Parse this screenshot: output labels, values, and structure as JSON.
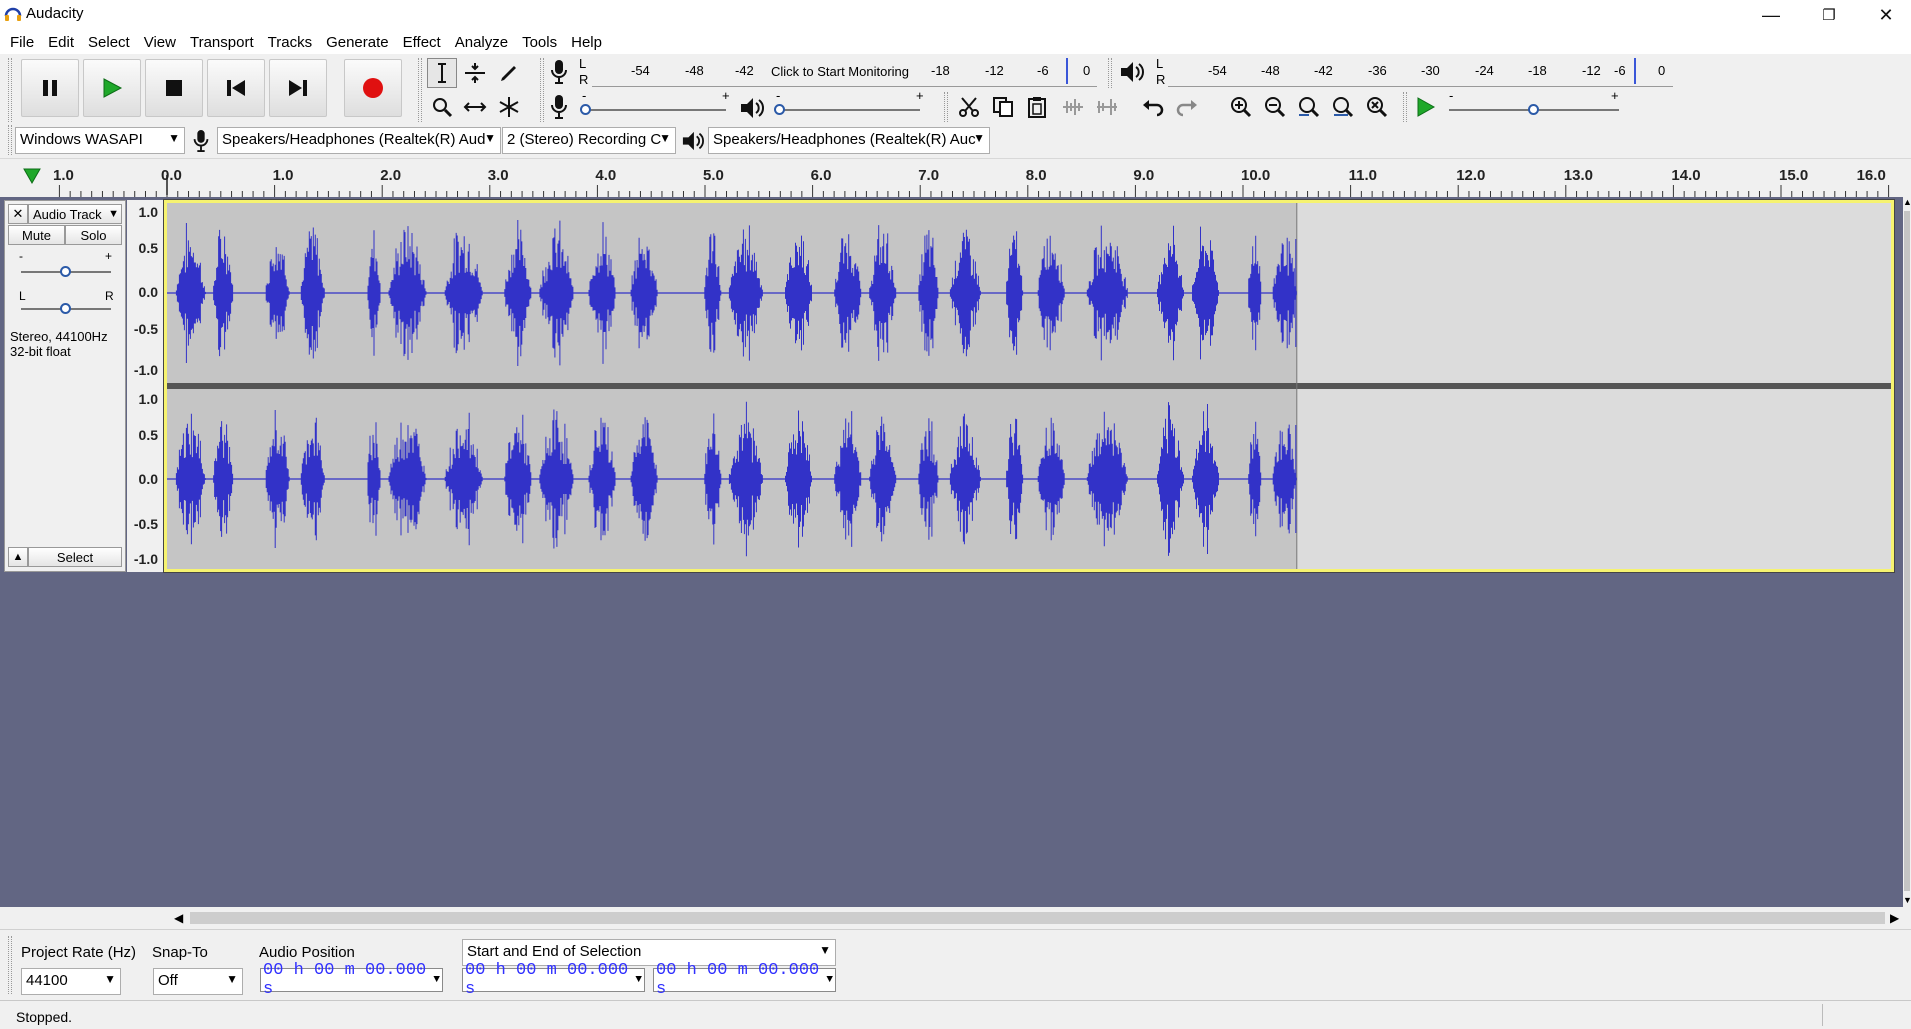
{
  "window": {
    "title": "Audacity",
    "minimize": "—",
    "maximize": "❐",
    "close": "✕"
  },
  "menu": [
    "File",
    "Edit",
    "Select",
    "View",
    "Transport",
    "Tracks",
    "Generate",
    "Effect",
    "Analyze",
    "Tools",
    "Help"
  ],
  "record_meter": {
    "channel_l": "L",
    "channel_r": "R",
    "ticks": [
      "-54",
      "-48",
      "-42",
      "-18",
      "-12",
      "-6",
      "0"
    ],
    "monitor_text": "Click to Start Monitoring"
  },
  "play_meter": {
    "channel_l": "L",
    "channel_r": "R",
    "ticks": [
      "-54",
      "-48",
      "-42",
      "-36",
      "-30",
      "-24",
      "-18",
      "-12",
      "-6",
      "0"
    ]
  },
  "sliders": {
    "minus": "-",
    "plus": "+",
    "rec_level": 0.0,
    "play_level": 0.0,
    "speed_level": 0.5
  },
  "devices": {
    "host": "Windows WASAPI",
    "recording_device": "Speakers/Headphones (Realtek(R) Aud",
    "channels": "2 (Stereo) Recording C",
    "playback_device": "Speakers/Headphones (Realtek(R) Auc"
  },
  "ruler": {
    "pre": "1.0",
    "labels": [
      "0.0",
      "1.0",
      "2.0",
      "3.0",
      "4.0",
      "5.0",
      "6.0",
      "7.0",
      "8.0",
      "9.0",
      "10.0",
      "11.0",
      "12.0",
      "13.0",
      "14.0",
      "15.0",
      "16.0"
    ]
  },
  "track": {
    "name": "Audio Track",
    "mute": "Mute",
    "solo": "Solo",
    "gain_minus": "-",
    "gain_plus": "+",
    "pan_l": "L",
    "pan_r": "R",
    "format_line1": "Stereo, 44100Hz",
    "format_line2": "32-bit float",
    "select": "Select",
    "close": "✕",
    "collapse": "▲",
    "menu_arrow": "▼",
    "gain_level": 0.5,
    "pan_level": 0.5,
    "clip_end_seconds": 10.5
  },
  "vruler": [
    "1.0",
    "0.5",
    "0.0",
    "-0.5",
    "-1.0"
  ],
  "selection_toolbar": {
    "project_rate_label": "Project Rate (Hz)",
    "project_rate": "44100",
    "snap_label": "Snap-To",
    "snap_value": "Off",
    "audio_position_label": "Audio Position",
    "audio_position": "00 h 00 m 00.000 s",
    "selection_mode": "Start and End of Selection",
    "selection_start": "00 h 00 m 00.000 s",
    "selection_end": "00 h 00 m 00.000 s"
  },
  "status": {
    "text": "Stopped."
  },
  "colors": {
    "wave": "#3232c8",
    "track_bg": "#626683",
    "selection": "#c5c5c5",
    "empty": "#dcdcdc",
    "record": "#e01010",
    "play": "#1fa82a",
    "focus": "#f6f370"
  }
}
